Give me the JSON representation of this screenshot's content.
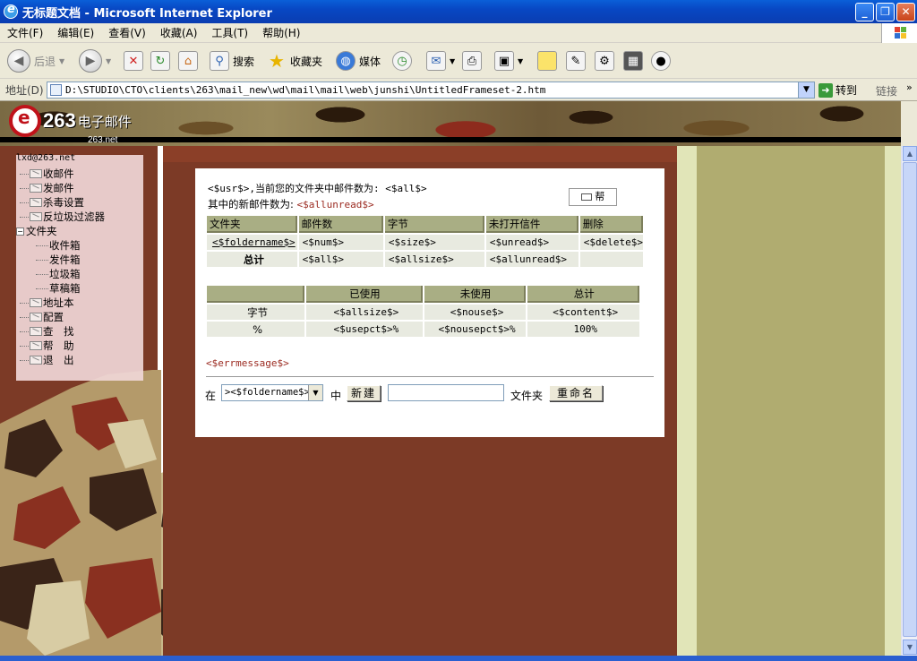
{
  "window": {
    "title": "无标题文档 - Microsoft Internet Explorer",
    "minimize": "_",
    "maximize": "❐",
    "close": "✕"
  },
  "menu": [
    "文件(F)",
    "编辑(E)",
    "查看(V)",
    "收藏(A)",
    "工具(T)",
    "帮助(H)"
  ],
  "toolbar": {
    "back": "后退",
    "search": "搜索",
    "favorites": "收藏夹",
    "media": "媒体"
  },
  "address": {
    "label": "地址(D)",
    "value": "D:\\STUDIO\\CTO\\clients\\263\\mail_new\\wd\\mail\\mail\\web\\junshi\\UntitledFrameset-2.htm",
    "go": "转到",
    "links": "链接"
  },
  "logo": {
    "num": "263",
    "text": "电子邮件",
    "sub": "263.net"
  },
  "tree": {
    "account": "lxd@263.net",
    "items": [
      "收邮件",
      "发邮件",
      "杀毒设置",
      "反垃圾过滤器"
    ],
    "folder_root": "文件夹",
    "folders": [
      "收件箱",
      "发件箱",
      "垃圾箱",
      "草稿箱"
    ],
    "items2": [
      "地址本",
      "配置",
      "查　找",
      "帮　助",
      "退　出"
    ]
  },
  "panel": {
    "line1_prefix": "<$usr$>,当前您的文件夹中邮件数为: ",
    "line1_value": "<$all$>",
    "line2_prefix": "其中的新邮件数为: ",
    "line2_value": "<$allunread$>",
    "help_button": "帮",
    "table1": {
      "headers": [
        "文件夹",
        "邮件数",
        "字节",
        "未打开信件",
        "删除"
      ],
      "row": [
        "<$foldername$>",
        "<$num$>",
        "<$size$>",
        "<$unread$>",
        "<$delete$>"
      ],
      "total": [
        "总计",
        "<$all$>",
        "<$allsize$>",
        "<$allunread$>",
        ""
      ]
    },
    "table2": {
      "headers": [
        "",
        "已使用",
        "未使用",
        "总计"
      ],
      "rows": [
        [
          "字节",
          "<$allsize$>",
          "<$nouse$>",
          "<$content$>"
        ],
        [
          "%",
          "<$usepct$>%",
          "<$nousepct$>%",
          "100%"
        ]
      ]
    },
    "errmessage": "<$errmessage$>",
    "form": {
      "in_label": "在",
      "select_value": "><$foldername$>",
      "middle_label": "中",
      "new_button": "新建",
      "input_value": "",
      "folder_label": "文件夹",
      "rename_button": "重命名"
    }
  }
}
